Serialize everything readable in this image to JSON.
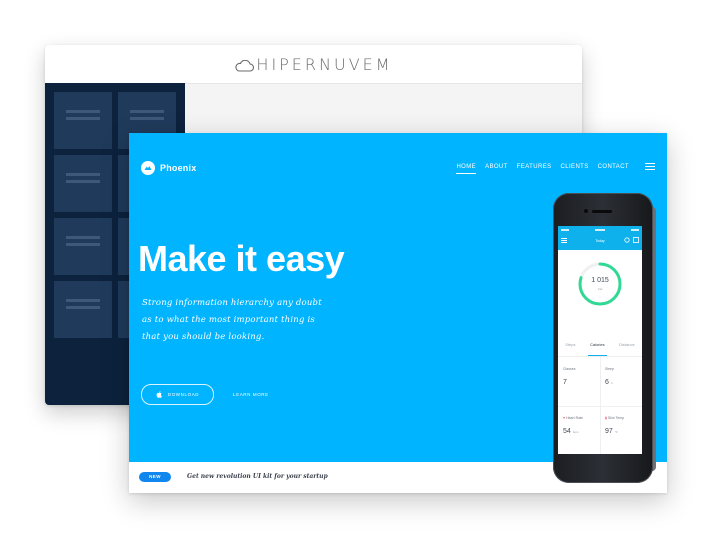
{
  "back_window": {
    "logo": "HIPERNUVEM"
  },
  "front_window": {
    "brand": "Phoenix",
    "nav": [
      {
        "label": "HOME",
        "active": true
      },
      {
        "label": "ABOUT",
        "active": false
      },
      {
        "label": "FEATURES",
        "active": false
      },
      {
        "label": "CLIENTS",
        "active": false
      },
      {
        "label": "CONTACT",
        "active": false
      }
    ],
    "hero": {
      "title": "Make it easy",
      "subtitle": "Strong information hierarchy any doubt as to what the most important thing is that you should be looking."
    },
    "buttons": {
      "download": "DOWNLOAD",
      "learn_more": "LEARN MORE"
    },
    "bottom_bar": {
      "badge": "NEW",
      "text": "Get new revolution UI kit for your startup"
    },
    "colors": {
      "hero_bg": "#00b4ff",
      "sidebar_bg": "#0c223d",
      "tile": "#1f3a5b",
      "badge": "#0f87ef"
    }
  },
  "phone": {
    "header_title": "Today",
    "ring_value": "1 015",
    "ring_unit": "Cal",
    "ring_progress": 0.8,
    "tabs": [
      {
        "label": "Steps",
        "active": false
      },
      {
        "label": "Calories",
        "active": true
      },
      {
        "label": "Distance",
        "active": false
      }
    ],
    "stats": [
      {
        "label": "Classes",
        "value": "7",
        "unit": ""
      },
      {
        "label": "Sleep",
        "value": "6",
        "unit": "h"
      },
      {
        "label": "Heart Rate",
        "value": "54",
        "unit": "bpm"
      },
      {
        "label": "Skin Temp",
        "value": "97",
        "unit": "°F"
      }
    ]
  }
}
